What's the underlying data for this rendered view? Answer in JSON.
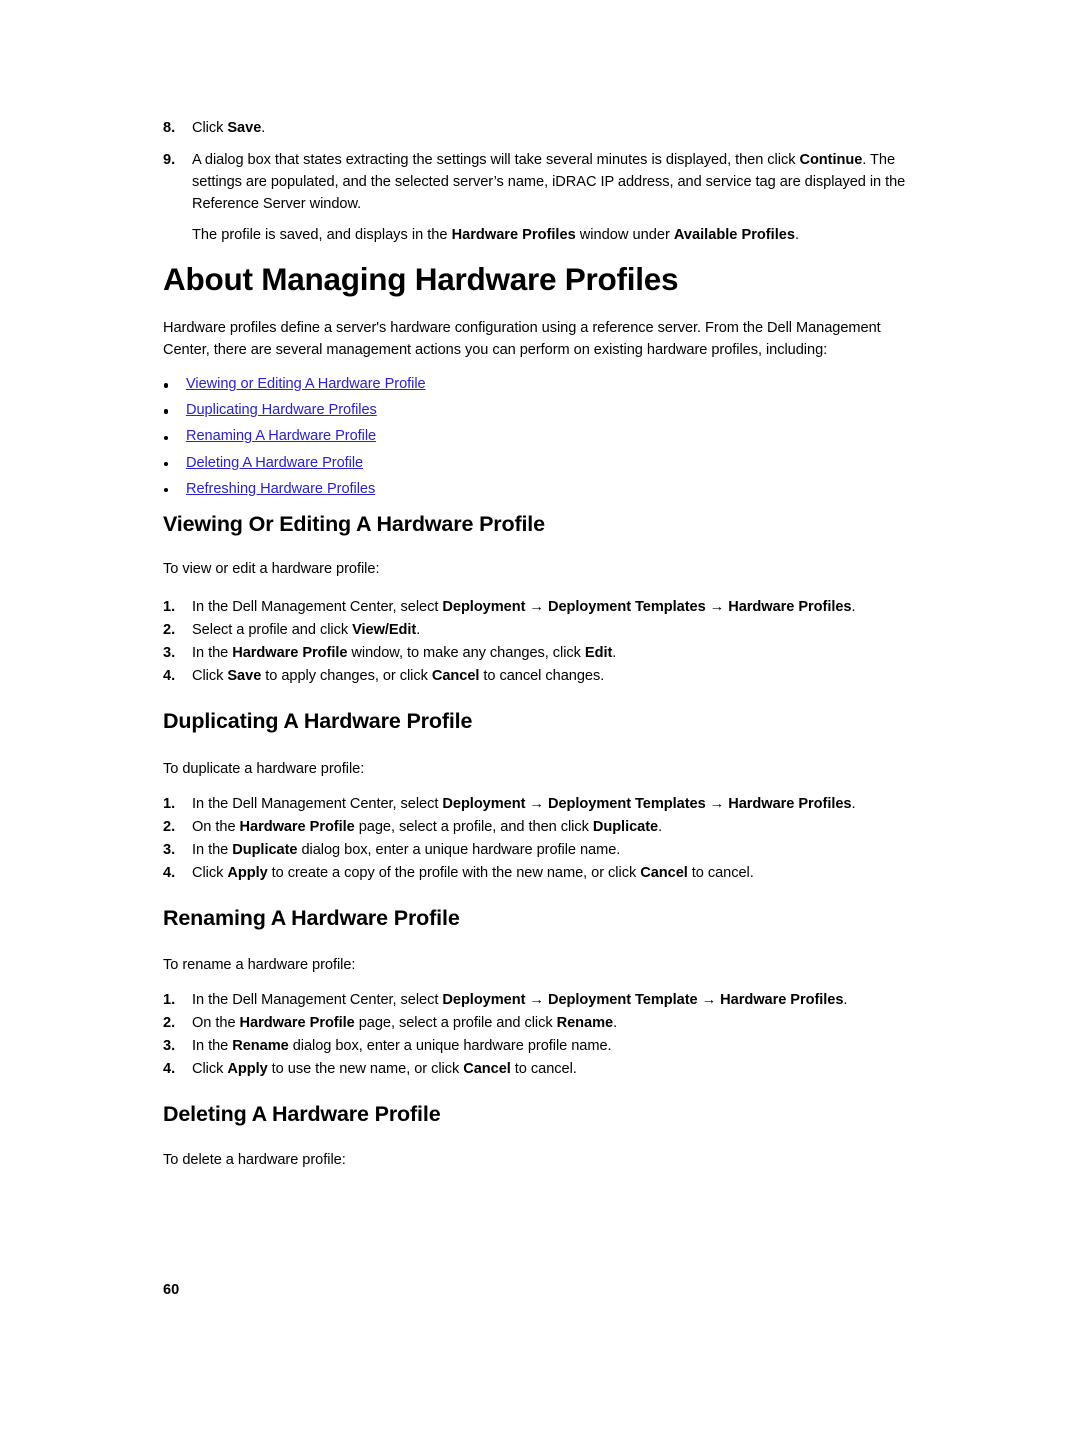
{
  "document": {
    "page_number": "60",
    "link_color": "#2b22c8",
    "text_color": "#000000",
    "background_color": "#ffffff"
  },
  "top_steps": {
    "items": [
      {
        "marker": "8.",
        "parts": [
          {
            "text": "Click ",
            "bold": false
          },
          {
            "text": "Save",
            "bold": true
          },
          {
            "text": ".",
            "bold": false
          }
        ]
      },
      {
        "marker": "9.",
        "parts": [
          {
            "text": "A dialog box that states extracting the settings will take several minutes is displayed, then click ",
            "bold": false
          },
          {
            "text": "Continue",
            "bold": true
          },
          {
            "text": ". The settings are populated, and the selected server’s name, iDRAC IP address, and service tag are displayed in the Reference Server window.",
            "bold": false
          }
        ]
      }
    ],
    "continuation": [
      {
        "text": "The profile is saved, and displays in the ",
        "bold": false
      },
      {
        "text": "Hardware Profiles",
        "bold": true
      },
      {
        "text": " window under ",
        "bold": false
      },
      {
        "text": "Available Profiles",
        "bold": true
      },
      {
        "text": ".",
        "bold": false
      }
    ]
  },
  "chapter": {
    "title": "About Managing Hardware Profiles",
    "intro": "Hardware profiles define a server's hardware configuration using a reference server. From the Dell Management Center, there are several management actions you can perform on existing hardware profiles, including:",
    "links": [
      "Viewing or Editing A Hardware Profile",
      "Duplicating Hardware Profiles",
      "Renaming A Hardware Profile",
      "Deleting A Hardware Profile",
      "Refreshing Hardware Profiles"
    ]
  },
  "sections": [
    {
      "heading": "Viewing Or Editing A Hardware Profile",
      "lead": "To view or edit a hardware profile:",
      "steps": [
        {
          "marker": "1.",
          "parts": [
            {
              "text": "In the Dell Management Center, select ",
              "bold": false
            },
            {
              "text": "Deployment",
              "bold": true
            },
            {
              "text": " → ",
              "bold": false,
              "arrow": true
            },
            {
              "text": "Deployment Templates",
              "bold": true
            },
            {
              "text": " → ",
              "bold": false,
              "arrow": true
            },
            {
              "text": "Hardware Profiles",
              "bold": true
            },
            {
              "text": ".",
              "bold": false
            }
          ]
        },
        {
          "marker": "2.",
          "parts": [
            {
              "text": "Select a profile and click ",
              "bold": false
            },
            {
              "text": "View/Edit",
              "bold": true
            },
            {
              "text": ".",
              "bold": false
            }
          ]
        },
        {
          "marker": "3.",
          "parts": [
            {
              "text": "In the ",
              "bold": false
            },
            {
              "text": "Hardware Profile",
              "bold": true
            },
            {
              "text": " window, to make any changes, click ",
              "bold": false
            },
            {
              "text": "Edit",
              "bold": true
            },
            {
              "text": ".",
              "bold": false
            }
          ]
        },
        {
          "marker": "4.",
          "parts": [
            {
              "text": "Click ",
              "bold": false
            },
            {
              "text": "Save",
              "bold": true
            },
            {
              "text": " to apply changes, or click ",
              "bold": false
            },
            {
              "text": "Cancel",
              "bold": true
            },
            {
              "text": " to cancel changes.",
              "bold": false
            }
          ]
        }
      ]
    },
    {
      "heading": "Duplicating A Hardware Profile",
      "lead": "To duplicate a hardware profile:",
      "steps": [
        {
          "marker": "1.",
          "parts": [
            {
              "text": "In the Dell Management Center, select ",
              "bold": false
            },
            {
              "text": "Deployment",
              "bold": true
            },
            {
              "text": " → ",
              "bold": false,
              "arrow": true
            },
            {
              "text": "Deployment Templates",
              "bold": true
            },
            {
              "text": " → ",
              "bold": false,
              "arrow": true
            },
            {
              "text": "Hardware Profiles",
              "bold": true
            },
            {
              "text": ".",
              "bold": false
            }
          ]
        },
        {
          "marker": "2.",
          "parts": [
            {
              "text": "On the ",
              "bold": false
            },
            {
              "text": "Hardware Profile",
              "bold": true
            },
            {
              "text": " page, select a profile, and then click ",
              "bold": false
            },
            {
              "text": "Duplicate",
              "bold": true
            },
            {
              "text": ".",
              "bold": false
            }
          ]
        },
        {
          "marker": "3.",
          "parts": [
            {
              "text": "In the ",
              "bold": false
            },
            {
              "text": "Duplicate",
              "bold": true
            },
            {
              "text": " dialog box, enter a unique hardware profile name.",
              "bold": false
            }
          ]
        },
        {
          "marker": "4.",
          "parts": [
            {
              "text": "Click ",
              "bold": false
            },
            {
              "text": "Apply",
              "bold": true
            },
            {
              "text": " to create a copy of the profile with the new name, or click ",
              "bold": false
            },
            {
              "text": "Cancel",
              "bold": true
            },
            {
              "text": " to cancel.",
              "bold": false
            }
          ]
        }
      ]
    },
    {
      "heading": "Renaming A Hardware Profile",
      "lead": "To rename a hardware profile:",
      "steps": [
        {
          "marker": "1.",
          "parts": [
            {
              "text": "In the Dell Management Center, select ",
              "bold": false
            },
            {
              "text": "Deployment",
              "bold": true
            },
            {
              "text": " → ",
              "bold": false,
              "arrow": true
            },
            {
              "text": "Deployment Template",
              "bold": true
            },
            {
              "text": " → ",
              "bold": false,
              "arrow": true
            },
            {
              "text": "Hardware Profiles",
              "bold": true
            },
            {
              "text": ".",
              "bold": false
            }
          ]
        },
        {
          "marker": "2.",
          "parts": [
            {
              "text": "On the ",
              "bold": false
            },
            {
              "text": "Hardware Profile",
              "bold": true
            },
            {
              "text": " page, select a profile and click ",
              "bold": false
            },
            {
              "text": "Rename",
              "bold": true
            },
            {
              "text": ".",
              "bold": false
            }
          ]
        },
        {
          "marker": "3.",
          "parts": [
            {
              "text": "In the ",
              "bold": false
            },
            {
              "text": "Rename",
              "bold": true
            },
            {
              "text": " dialog box, enter a unique hardware profile name.",
              "bold": false
            }
          ]
        },
        {
          "marker": "4.",
          "parts": [
            {
              "text": "Click ",
              "bold": false
            },
            {
              "text": "Apply",
              "bold": true
            },
            {
              "text": " to use the new name, or click ",
              "bold": false
            },
            {
              "text": "Cancel",
              "bold": true
            },
            {
              "text": " to cancel.",
              "bold": false
            }
          ]
        }
      ]
    },
    {
      "heading": "Deleting A Hardware Profile",
      "lead": "To delete a hardware profile:",
      "steps": []
    }
  ]
}
